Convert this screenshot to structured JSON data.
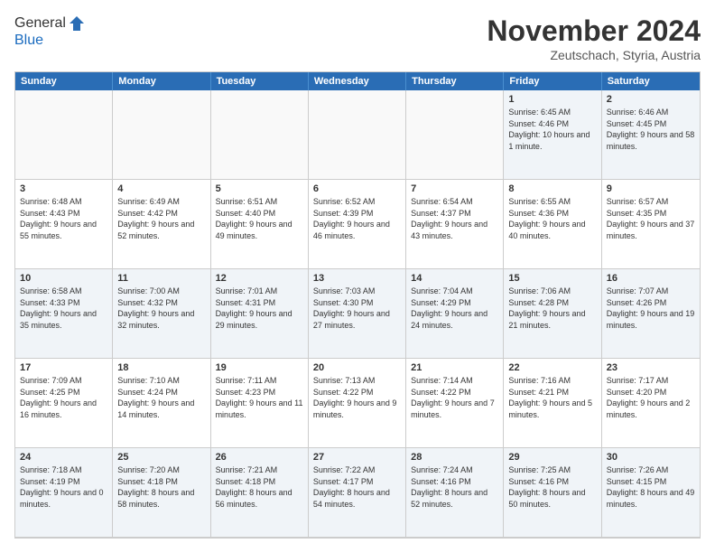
{
  "header": {
    "logo_general": "General",
    "logo_blue": "Blue",
    "month_year": "November 2024",
    "location": "Zeutschach, Styria, Austria"
  },
  "weekdays": [
    "Sunday",
    "Monday",
    "Tuesday",
    "Wednesday",
    "Thursday",
    "Friday",
    "Saturday"
  ],
  "weeks": [
    [
      {
        "day": "",
        "info": "",
        "empty": true
      },
      {
        "day": "",
        "info": "",
        "empty": true
      },
      {
        "day": "",
        "info": "",
        "empty": true
      },
      {
        "day": "",
        "info": "",
        "empty": true
      },
      {
        "day": "",
        "info": "",
        "empty": true
      },
      {
        "day": "1",
        "info": "Sunrise: 6:45 AM\nSunset: 4:46 PM\nDaylight: 10 hours and 1 minute."
      },
      {
        "day": "2",
        "info": "Sunrise: 6:46 AM\nSunset: 4:45 PM\nDaylight: 9 hours and 58 minutes."
      }
    ],
    [
      {
        "day": "3",
        "info": "Sunrise: 6:48 AM\nSunset: 4:43 PM\nDaylight: 9 hours and 55 minutes."
      },
      {
        "day": "4",
        "info": "Sunrise: 6:49 AM\nSunset: 4:42 PM\nDaylight: 9 hours and 52 minutes."
      },
      {
        "day": "5",
        "info": "Sunrise: 6:51 AM\nSunset: 4:40 PM\nDaylight: 9 hours and 49 minutes."
      },
      {
        "day": "6",
        "info": "Sunrise: 6:52 AM\nSunset: 4:39 PM\nDaylight: 9 hours and 46 minutes."
      },
      {
        "day": "7",
        "info": "Sunrise: 6:54 AM\nSunset: 4:37 PM\nDaylight: 9 hours and 43 minutes."
      },
      {
        "day": "8",
        "info": "Sunrise: 6:55 AM\nSunset: 4:36 PM\nDaylight: 9 hours and 40 minutes."
      },
      {
        "day": "9",
        "info": "Sunrise: 6:57 AM\nSunset: 4:35 PM\nDaylight: 9 hours and 37 minutes."
      }
    ],
    [
      {
        "day": "10",
        "info": "Sunrise: 6:58 AM\nSunset: 4:33 PM\nDaylight: 9 hours and 35 minutes."
      },
      {
        "day": "11",
        "info": "Sunrise: 7:00 AM\nSunset: 4:32 PM\nDaylight: 9 hours and 32 minutes."
      },
      {
        "day": "12",
        "info": "Sunrise: 7:01 AM\nSunset: 4:31 PM\nDaylight: 9 hours and 29 minutes."
      },
      {
        "day": "13",
        "info": "Sunrise: 7:03 AM\nSunset: 4:30 PM\nDaylight: 9 hours and 27 minutes."
      },
      {
        "day": "14",
        "info": "Sunrise: 7:04 AM\nSunset: 4:29 PM\nDaylight: 9 hours and 24 minutes."
      },
      {
        "day": "15",
        "info": "Sunrise: 7:06 AM\nSunset: 4:28 PM\nDaylight: 9 hours and 21 minutes."
      },
      {
        "day": "16",
        "info": "Sunrise: 7:07 AM\nSunset: 4:26 PM\nDaylight: 9 hours and 19 minutes."
      }
    ],
    [
      {
        "day": "17",
        "info": "Sunrise: 7:09 AM\nSunset: 4:25 PM\nDaylight: 9 hours and 16 minutes."
      },
      {
        "day": "18",
        "info": "Sunrise: 7:10 AM\nSunset: 4:24 PM\nDaylight: 9 hours and 14 minutes."
      },
      {
        "day": "19",
        "info": "Sunrise: 7:11 AM\nSunset: 4:23 PM\nDaylight: 9 hours and 11 minutes."
      },
      {
        "day": "20",
        "info": "Sunrise: 7:13 AM\nSunset: 4:22 PM\nDaylight: 9 hours and 9 minutes."
      },
      {
        "day": "21",
        "info": "Sunrise: 7:14 AM\nSunset: 4:22 PM\nDaylight: 9 hours and 7 minutes."
      },
      {
        "day": "22",
        "info": "Sunrise: 7:16 AM\nSunset: 4:21 PM\nDaylight: 9 hours and 5 minutes."
      },
      {
        "day": "23",
        "info": "Sunrise: 7:17 AM\nSunset: 4:20 PM\nDaylight: 9 hours and 2 minutes."
      }
    ],
    [
      {
        "day": "24",
        "info": "Sunrise: 7:18 AM\nSunset: 4:19 PM\nDaylight: 9 hours and 0 minutes."
      },
      {
        "day": "25",
        "info": "Sunrise: 7:20 AM\nSunset: 4:18 PM\nDaylight: 8 hours and 58 minutes."
      },
      {
        "day": "26",
        "info": "Sunrise: 7:21 AM\nSunset: 4:18 PM\nDaylight: 8 hours and 56 minutes."
      },
      {
        "day": "27",
        "info": "Sunrise: 7:22 AM\nSunset: 4:17 PM\nDaylight: 8 hours and 54 minutes."
      },
      {
        "day": "28",
        "info": "Sunrise: 7:24 AM\nSunset: 4:16 PM\nDaylight: 8 hours and 52 minutes."
      },
      {
        "day": "29",
        "info": "Sunrise: 7:25 AM\nSunset: 4:16 PM\nDaylight: 8 hours and 50 minutes."
      },
      {
        "day": "30",
        "info": "Sunrise: 7:26 AM\nSunset: 4:15 PM\nDaylight: 8 hours and 49 minutes."
      }
    ]
  ]
}
